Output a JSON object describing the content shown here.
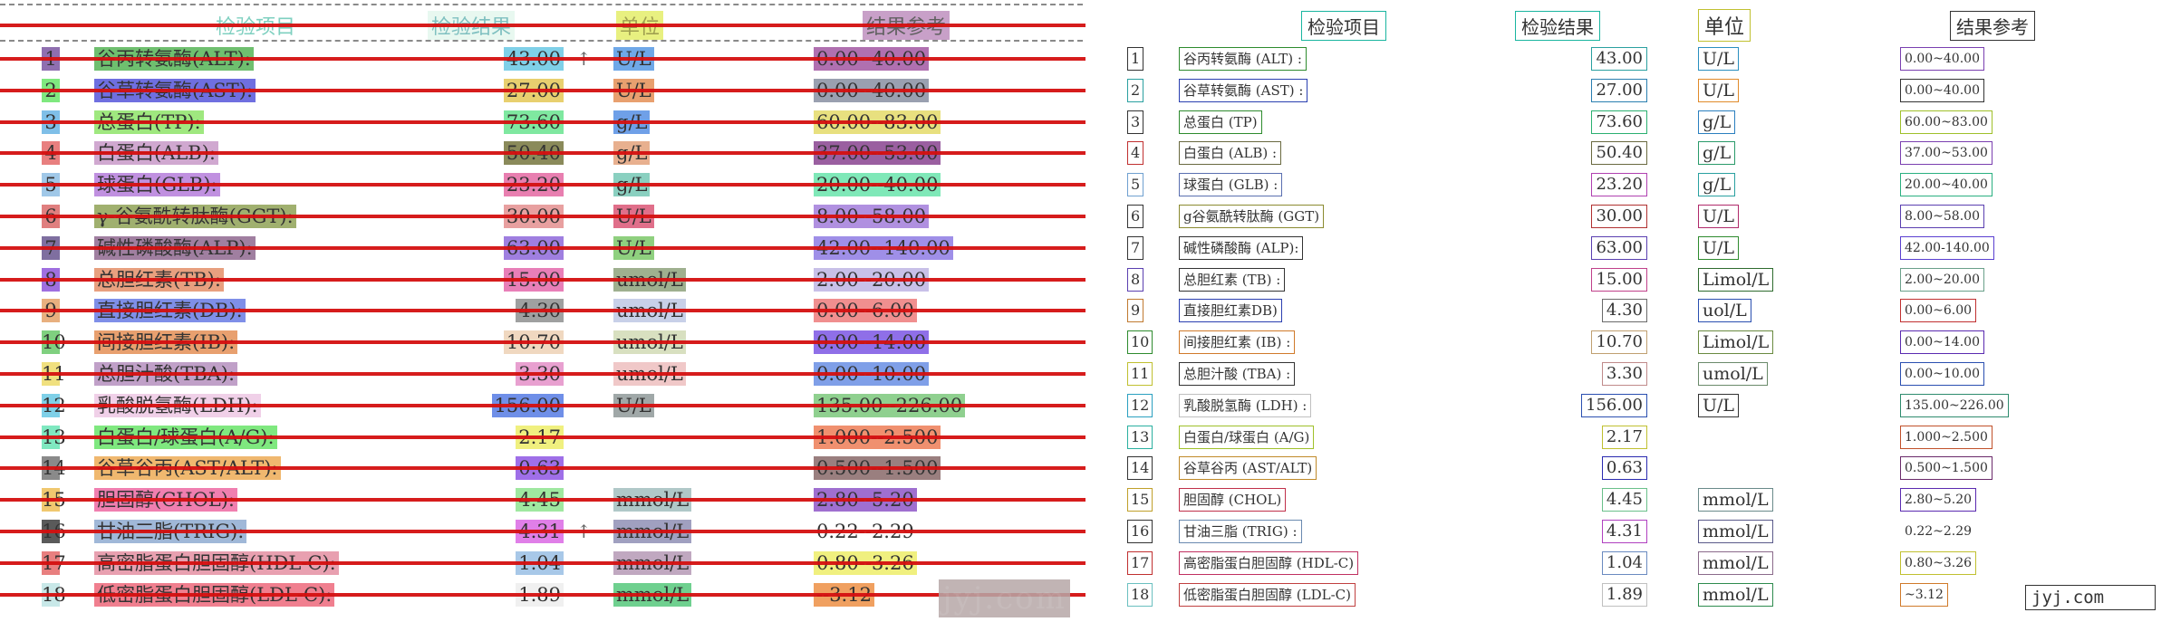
{
  "headers": {
    "item": "检验项目",
    "result": "检验结果",
    "unit": "单位",
    "reference": "结果参考"
  },
  "left_rows": [
    {
      "no": "1",
      "name": "谷丙转氨酶(ALT):",
      "result": "43.00",
      "flag": "↑",
      "unit": "U/L",
      "ref": "0.00--40.00",
      "c": [
        "#8f6fb0",
        "#6fbf6f",
        "#7fd0e8",
        "#6fa8e8",
        "#b070b0"
      ]
    },
    {
      "no": "2",
      "name": "谷草转氨酶(AST):",
      "result": "27.00",
      "flag": "",
      "unit": "U/L",
      "ref": "0.00--40.00",
      "c": [
        "#7fe87f",
        "#6f6fe0",
        "#e8d06f",
        "#e8a06f",
        "#9aa0b0"
      ]
    },
    {
      "no": "3",
      "name": "总蛋白(TP):",
      "result": "73.60",
      "flag": "",
      "unit": "g/L",
      "ref": "60.00--83.00",
      "c": [
        "#7fbfe8",
        "#9fe87f",
        "#7fe8a0",
        "#6fa0e8",
        "#e8e07f"
      ]
    },
    {
      "no": "4",
      "name": "白蛋白(ALB):",
      "result": "50.40",
      "flag": "",
      "unit": "g/L",
      "ref": "37.00--53.00",
      "c": [
        "#e87f7f",
        "#d0a8d0",
        "#8a8a5a",
        "#e8b08f",
        "#9a5fa0"
      ]
    },
    {
      "no": "5",
      "name": "球蛋白(GLB):",
      "result": "23.20",
      "flag": "",
      "unit": "g/L",
      "ref": "20.00--40.00",
      "c": [
        "#a0c8e8",
        "#c090e0",
        "#e87fb0",
        "#8ad0c0",
        "#7fe8b8"
      ]
    },
    {
      "no": "6",
      "name": "γ-谷氨酰转肽酶(GGT):",
      "result": "30.00",
      "flag": "",
      "unit": "U/L",
      "ref": "8.00--58.00",
      "c": [
        "#e07f7f",
        "#a0b06f",
        "#e8a0a0",
        "#e06f8a",
        "#b090e0"
      ]
    },
    {
      "no": "7",
      "name": "碱性磷酸酶(ALP):",
      "result": "63.00",
      "flag": "",
      "unit": "U/L",
      "ref": "42.00--140.00",
      "c": [
        "#7f6fa0",
        "#a07fa0",
        "#9f7fe0",
        "#8fd07f",
        "#9f8fe8"
      ]
    },
    {
      "no": "8",
      "name": "总胆红素(TB):",
      "result": "15.00",
      "flag": "",
      "unit": "umol/L",
      "ref": "2.00--20.00",
      "c": [
        "#9f6fe0",
        "#e8a07f",
        "#e87fb8",
        "#9fb08f",
        "#c8c0e8"
      ]
    },
    {
      "no": "9",
      "name": "直接胆红素(DB):",
      "result": "4.30",
      "flag": "",
      "unit": "umol/L",
      "ref": "0.00--6.00",
      "c": [
        "#e8b07f",
        "#7f8fe8",
        "#9fa0a0",
        "#c8d0e8",
        "#f08f8f"
      ]
    },
    {
      "no": "10",
      "name": "间接胆红素(IB):",
      "result": "10.70",
      "flag": "",
      "unit": "umol/L",
      "ref": "0.00--14.00",
      "c": [
        "#7fd07f",
        "#e8a06f",
        "#f0d8c0",
        "#d8e0c0",
        "#8f6fe8"
      ]
    },
    {
      "no": "11",
      "name": "总胆汁酸(TBA):",
      "result": "3.30",
      "flag": "",
      "unit": "umol/L",
      "ref": "0.00--10.00",
      "c": [
        "#f0e07f",
        "#c0a0c8",
        "#e8a0d0",
        "#f0c8c8",
        "#7f9fe8"
      ]
    },
    {
      "no": "12",
      "name": "乳酸脱氢酶(LDH):",
      "result": "156.00",
      "flag": "",
      "unit": "U/L",
      "ref": "135.00--226.00",
      "c": [
        "#7fd0e8",
        "#f0d0e8",
        "#6f8fe8",
        "#a0a8a8",
        "#8fd08f"
      ]
    },
    {
      "no": "13",
      "name": "白蛋白/球蛋白(A/G):",
      "result": "2.17",
      "flag": "",
      "unit": "",
      "ref": "1.000--2.500",
      "c": [
        "#7fe8c0",
        "#7fe87f",
        "#f0f07f",
        "#ffffff",
        "#f0906f"
      ]
    },
    {
      "no": "14",
      "name": "谷草谷丙(AST/ALT):",
      "result": "0.63",
      "flag": "",
      "unit": "",
      "ref": "0.500--1.500",
      "c": [
        "#8a8a8a",
        "#f0b86f",
        "#9f6fe8",
        "#ffffff",
        "#9a7f7f"
      ]
    },
    {
      "no": "15",
      "name": "胆固醇(CHOL):",
      "result": "4.45",
      "flag": "",
      "unit": "mmol/L",
      "ref": "2.80--5.20",
      "c": [
        "#f0c86f",
        "#f07fb0",
        "#9fe8a0",
        "#b0c8c8",
        "#9f6fd0"
      ]
    },
    {
      "no": "16",
      "name": "甘油三脂(TRIG):",
      "result": "4.31",
      "flag": "↑",
      "unit": "mmol/L",
      "ref": "0.22--2.29",
      "c": [
        "#5a5a5a",
        "#a0b8d8",
        "#e07fe8",
        "#a0a0c0",
        "#ffffff"
      ]
    },
    {
      "no": "17",
      "name": "高密脂蛋白胆固醇(HDL-C):",
      "result": "1.04",
      "flag": "",
      "unit": "mmol/L",
      "ref": "0.80--3.26",
      "c": [
        "#e87f7f",
        "#e8a0b0",
        "#a8c8e8",
        "#c0a8c0",
        "#f0f07f"
      ]
    },
    {
      "no": "18",
      "name": "低密脂蛋白胆固醇(LDL-C):",
      "result": "1.89",
      "flag": "",
      "unit": "mmol/L",
      "ref": "--3.12",
      "c": [
        "#c8e8e8",
        "#f07f8f",
        "#f0f0f0",
        "#6fd08f",
        "#f0a060"
      ]
    }
  ],
  "right_rows": [
    {
      "no": "1",
      "name": "谷丙转氨酶 (ALT) :",
      "result": "43.00",
      "unit": "U/L",
      "ref": "0.00~40.00",
      "c": [
        "#333",
        "#2e8b2e",
        "#2aa0a0",
        "#2a8fbf",
        "#7a3fb0"
      ]
    },
    {
      "no": "2",
      "name": "谷草转氨酶 (AST) :",
      "result": "27.00",
      "unit": "U/L",
      "ref": "0.00~40.00",
      "c": [
        "#2aa0a0",
        "#2a3fb0",
        "#2a7fb0",
        "#e08a2a",
        "#333"
      ]
    },
    {
      "no": "3",
      "name": "总蛋白 (TP)",
      "result": "73.60",
      "unit": "g/L",
      "ref": "60.00~83.00",
      "c": [
        "#333",
        "#2e8b2e",
        "#2ab070",
        "#2a7fbf",
        "#9fc02a"
      ]
    },
    {
      "no": "4",
      "name": "白蛋白 (ALB) :",
      "result": "50.40",
      "unit": "g/L",
      "ref": "37.00~53.00",
      "c": [
        "#c03030",
        "#6a6a40",
        "#6a6a40",
        "#2a9a6a",
        "#7a3fb0"
      ]
    },
    {
      "no": "5",
      "name": "球蛋白 (GLB) :",
      "result": "23.20",
      "unit": "g/L",
      "ref": "20.00~40.00",
      "c": [
        "#6fa0d0",
        "#5a6fb0",
        "#b040b0",
        "#2aa0a0",
        "#2ab080"
      ]
    },
    {
      "no": "6",
      "name": "g谷氨酰转肽酶 (GGT)",
      "result": "30.00",
      "unit": "U/L",
      "ref": "8.00~58.00",
      "c": [
        "#333",
        "#8a8a30",
        "#b03030",
        "#b02a6a",
        "#5a3fb0"
      ]
    },
    {
      "no": "7",
      "name": "碱性磷酸酶 (ALP):",
      "result": "63.00",
      "unit": "U/L",
      "ref": "42.00-140.00",
      "c": [
        "#333",
        "#333",
        "#5a3fb0",
        "#2e8b2e",
        "#5a3fd0"
      ]
    },
    {
      "no": "8",
      "name": "总胆红素 (TB) :",
      "result": "15.00",
      "unit": "Limol/L",
      "ref": "2.00~20.00",
      "c": [
        "#5a3fb0",
        "#333",
        "#c0408a",
        "#2e6b2e",
        "#6aa08a"
      ]
    },
    {
      "no": "9",
      "name": "直接胆红素DB)",
      "result": "4.30",
      "unit": "uol/L",
      "ref": "0.00~6.00",
      "c": [
        "#c07a30",
        "#2a3fb0",
        "#6a6a6a",
        "#2a4fb0",
        "#c03030"
      ]
    },
    {
      "no": "10",
      "name": "间接胆红素 (IB) :",
      "result": "10.70",
      "unit": "Limol/L",
      "ref": "0.00~14.00",
      "c": [
        "#2e8b2e",
        "#d07a2a",
        "#c0a070",
        "#6a8a40",
        "#5a2ab0"
      ]
    },
    {
      "no": "11",
      "name": "总胆汁酸 (TBA) :",
      "result": "3.30",
      "unit": "umol/L",
      "ref": "0.00~10.00",
      "c": [
        "#c0c030",
        "#333",
        "#c08a8a",
        "#6a8a6a",
        "#2a4fb0"
      ]
    },
    {
      "no": "12",
      "name": "乳酸脱氢酶 (LDH) :",
      "result": "156.00",
      "unit": "U/L",
      "ref": "135.00~226.00",
      "c": [
        "#2aa0c0",
        "#c0c0c0",
        "#2a4fb0",
        "#333",
        "#2e8b6e"
      ]
    },
    {
      "no": "13",
      "name": "白蛋白/球蛋白 (A/G)",
      "result": "2.17",
      "unit": "",
      "ref": "1.000~2.500",
      "c": [
        "#2ab0a0",
        "#9fc02a",
        "#c0c030",
        "#ffffff",
        "#c0502a"
      ]
    },
    {
      "no": "14",
      "name": "谷草谷丙 (AST/ALT)",
      "result": "0.63",
      "unit": "",
      "ref": "0.500~1.500",
      "c": [
        "#333",
        "#c08a2a",
        "#2a2ab0",
        "#ffffff",
        "#6a2a6a"
      ]
    },
    {
      "no": "15",
      "name": "胆固醇 (CHOL)",
      "result": "4.45",
      "unit": "mmol/L",
      "ref": "2.80~5.20",
      "c": [
        "#c0a02a",
        "#c0304a",
        "#6ac08a",
        "#6a8a8a",
        "#5a2ab0"
      ]
    },
    {
      "no": "16",
      "name": "甘油三脂 (TRIG) :",
      "result": "4.31",
      "unit": "mmol/L",
      "ref": "0.22~2.29",
      "c": [
        "#333",
        "#6a8ab0",
        "#b040c0",
        "#5a5a8a",
        "#ffffff"
      ]
    },
    {
      "no": "17",
      "name": "高密脂蛋白胆固醇 (HDL-C)",
      "result": "1.04",
      "unit": "mmol/L",
      "ref": "0.80~3.26",
      "c": [
        "#c03030",
        "#c03060",
        "#6a8ac0",
        "#8a6a8a",
        "#c0c030"
      ]
    },
    {
      "no": "18",
      "name": "低密脂蛋白胆固醇 (LDL-C)",
      "result": "1.89",
      "unit": "mmol/L",
      "ref": "~3.12",
      "c": [
        "#6ac0c0",
        "#c04040",
        "#c0c0c0",
        "#2e8b4e",
        "#d07a2a"
      ]
    }
  ],
  "watermark": "jyj.com",
  "brand": "jyj.com"
}
